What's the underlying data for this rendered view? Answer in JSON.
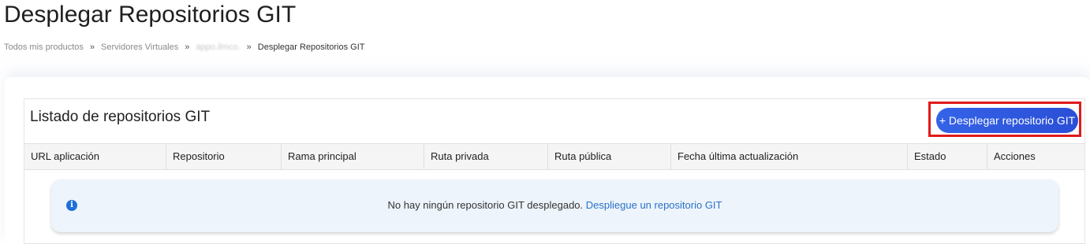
{
  "page": {
    "title": "Desplegar Repositorios GIT"
  },
  "breadcrumb": {
    "items": [
      "Todos mis productos",
      "Servidores Virtuales",
      "appo.ilmco.",
      "Desplegar Repositorios GIT"
    ],
    "separator": "»"
  },
  "list": {
    "title": "Listado de repositorios GIT",
    "deploy_button": "+ Desplegar repositorio GIT",
    "columns": [
      "URL aplicación",
      "Repositorio",
      "Rama principal",
      "Ruta privada",
      "Ruta pública",
      "Fecha última actualización",
      "Estado",
      "Acciones"
    ]
  },
  "empty_state": {
    "icon": "info-icon",
    "message": "No hay ningún repositorio GIT desplegado.",
    "link_text": "Despliegue un repositorio GIT"
  },
  "colors": {
    "accent": "#3563e8",
    "highlight": "#e01a1a",
    "info_bg": "#edf4fb",
    "link": "#2a72c9"
  }
}
